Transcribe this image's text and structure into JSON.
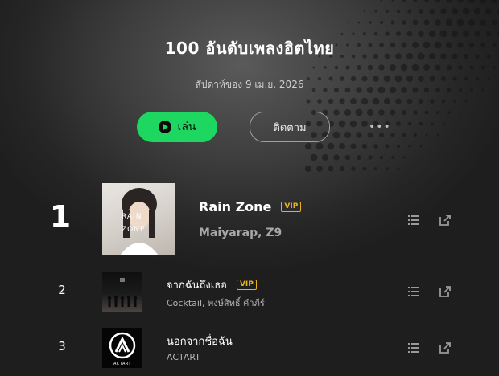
{
  "header": {
    "title": "100 อันดับเพลงฮิตไทย",
    "subtitle": "สัปดาห์ของ 9 เม.ย. 2026"
  },
  "actions": {
    "play_label": "เล่น",
    "follow_label": "ติดตาม",
    "more_label": "•••"
  },
  "colors": {
    "accent": "#1ed760",
    "vip": "#e8b21e",
    "background": "#1c1c1c"
  },
  "tracks": [
    {
      "rank": "1",
      "title": "Rain Zone",
      "artist": "Maiyarap, Z9",
      "vip": "VIP",
      "cover_text": "RAIN ZONE"
    },
    {
      "rank": "2",
      "title": "จากฉันถึงเธอ",
      "artist": "Cocktail, พงษ์สิทธิ์ คำภีร์",
      "vip": "VIP"
    },
    {
      "rank": "3",
      "title": "นอกจากชื่อฉัน",
      "artist": "ACTART",
      "cover_text": "ACTART"
    }
  ]
}
